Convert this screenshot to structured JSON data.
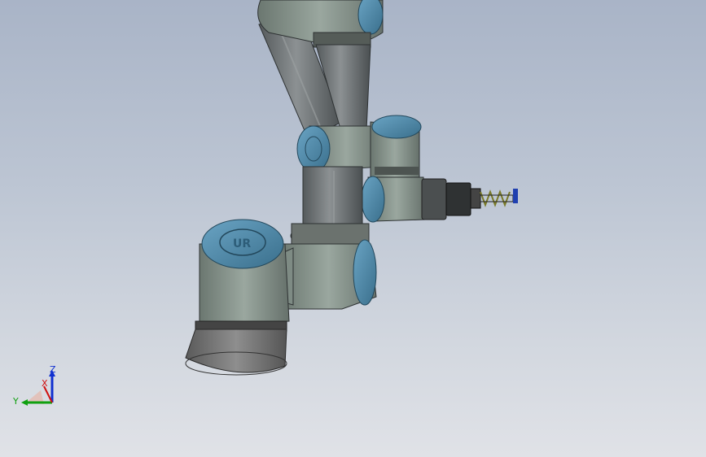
{
  "triad": {
    "x_label": "X",
    "y_label": "Y",
    "z_label": "Z",
    "x_color": "#d01010",
    "y_color": "#10a010",
    "z_color": "#1030d0"
  },
  "colors": {
    "background_top": "#a9b4c7",
    "background_bottom": "#e0e2e7",
    "arm_body": "#8a978f",
    "arm_dark": "#4e5652",
    "link_tube": "#6f7475",
    "joint_cap": "#4f87a6",
    "base_ring": "#6c6c6c"
  }
}
